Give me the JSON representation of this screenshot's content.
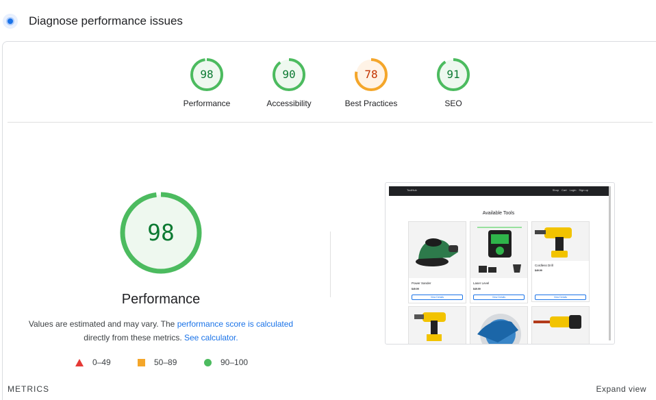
{
  "header": {
    "title": "Diagnose performance issues",
    "logo_icon": "lighthouse-icon"
  },
  "gauges": [
    {
      "score": "98",
      "label": "Performance",
      "status": "pass",
      "value": 98
    },
    {
      "score": "90",
      "label": "Accessibility",
      "status": "pass",
      "value": 90
    },
    {
      "score": "78",
      "label": "Best Practices",
      "status": "average",
      "value": 78
    },
    {
      "score": "91",
      "label": "SEO",
      "status": "pass",
      "value": 91
    }
  ],
  "main": {
    "score": "98",
    "value": 98,
    "title": "Performance",
    "desc_part1": "Values are estimated and may vary. The",
    "desc_link1": "performance score is calculated",
    "desc_part2": "directly from these metrics.",
    "desc_link2": "See calculator."
  },
  "legend": [
    {
      "range": "0–49",
      "icon": "triangle-icon",
      "color": "#e53935"
    },
    {
      "range": "50–89",
      "icon": "square-icon",
      "color": "#f4a62a"
    },
    {
      "range": "90–100",
      "icon": "circle-icon",
      "color": "#4cbb5f"
    }
  ],
  "metrics": {
    "label": "METRICS",
    "expand_label": "Expand view"
  },
  "screenshot": {
    "brand": "ToolHub",
    "nav": [
      "Shop",
      "Cart",
      "Login",
      "Sign up"
    ],
    "heading": "Available Tools",
    "products": [
      {
        "name": "Power Sander",
        "price": "$49.99",
        "button": "View Details"
      },
      {
        "name": "Laser Level",
        "price": "$49.99",
        "button": "View Details"
      },
      {
        "name": "Cordless Drill",
        "price": "$49.99",
        "button": "View Details"
      }
    ]
  },
  "colors": {
    "pass": "#0c7a32",
    "pass_ring": "#4cbb5f",
    "pass_bg": "#eef8ef",
    "average": "#c33300",
    "average_ring": "#f4a62a",
    "average_bg": "#fff3e6",
    "link": "#1a73e8"
  }
}
